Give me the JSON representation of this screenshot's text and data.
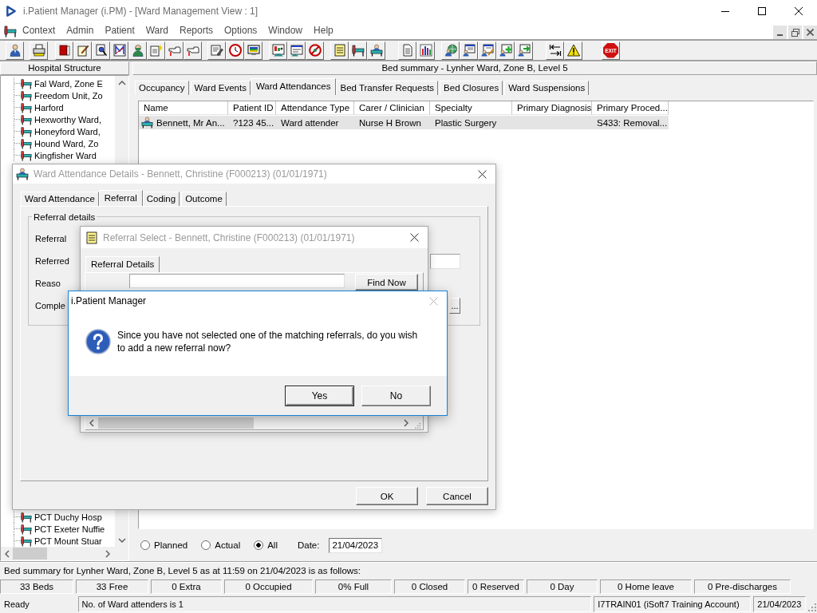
{
  "window": {
    "title": "i.Patient Manager (i.PM) - [Ward Management View : 1]",
    "active": false
  },
  "menu": [
    "Context",
    "Admin",
    "Patient",
    "Ward",
    "Reports",
    "Options",
    "Window",
    "Help"
  ],
  "toolbar": {
    "exit_label": "EXIT"
  },
  "hospital_structure": {
    "title": "Hospital Structure",
    "items_top": [
      "Fal Ward, Zone E",
      "Freedom Unit, Zo",
      "Harford",
      "Hexworthy Ward,",
      "Honeyford Ward,",
      "Hound Ward, Zo",
      "Kingfisher Ward"
    ],
    "items_bottom": [
      "PCT Duchy Hosp",
      "PCT Exeter Nuffie",
      "PCT Mount Stuar"
    ]
  },
  "ward_view": {
    "title": "Bed summary - Lynher Ward, Zone B, Level 5",
    "tabs": [
      {
        "label": "Occupancy",
        "selected": false
      },
      {
        "label": "Ward Events",
        "selected": false
      },
      {
        "label": "Ward Attendances",
        "selected": true
      },
      {
        "label": "Bed Transfer Requests",
        "selected": false
      },
      {
        "label": "Bed Closures",
        "selected": false
      },
      {
        "label": "Ward Suspensions",
        "selected": false
      }
    ],
    "table": {
      "columns": [
        "Name",
        "Patient ID",
        "Attendance Type",
        "Carer / Clinician",
        "Specialty",
        "Primary Diagnosis",
        "Primary Proced..."
      ],
      "rows": [
        {
          "selected": true,
          "name": "Bennett, Mr An...",
          "patient_id": "?123 45...",
          "attendance_type": "Ward attender",
          "carer_clinician": "Nurse H Brown",
          "specialty": "Plastic Surgery",
          "primary_procedure": "S433: Removal..."
        }
      ]
    },
    "filter": {
      "options": [
        {
          "label": "Planned",
          "selected": false
        },
        {
          "label": "Actual",
          "selected": false
        },
        {
          "label": "All",
          "selected": true
        }
      ],
      "date_label": "Date:",
      "date": "21/04/2023"
    }
  },
  "bed_summary": {
    "text": "Bed summary for Lynher Ward, Zone B, Level 5 as at 11:59 on 21/04/2023 is as follows:",
    "counts": [
      "33 Beds",
      "33 Free",
      "0 Extra",
      "0 Occupied",
      "0% Full",
      "0 Closed",
      "0 Reserved",
      "0 Day",
      "0 Home leave",
      "0 Pre-discharges"
    ]
  },
  "status_bar": [
    "Ready",
    "No. of Ward attenders is 1",
    "I7TRAIN01 (iSoft7 Training Account)",
    "21/04/2023"
  ],
  "ward_attendance_dialog": {
    "title": "Ward Attendance Details - Bennett, Christine (F000213) (01/01/1971)",
    "active": false,
    "tabs": [
      {
        "label": "Ward Attendance",
        "selected": false
      },
      {
        "label": "Referral",
        "selected": true
      },
      {
        "label": "Coding",
        "selected": false
      },
      {
        "label": "Outcome",
        "selected": false
      }
    ],
    "group_title": "Referral details",
    "field_labels": [
      "Referral",
      "Referred",
      "Reaso",
      "Comple"
    ],
    "browse_button": "...",
    "buttons": [
      "OK",
      "Cancel"
    ]
  },
  "referral_select_dialog": {
    "title": "Referral Select - Bennett, Christine (F000213) (01/01/1971)",
    "active": false,
    "tabs": [
      {
        "label": "Referral Details",
        "selected": true
      }
    ],
    "find_button": "Find Now"
  },
  "message_box": {
    "title": "i.Patient Manager",
    "active": true,
    "close_disabled": true,
    "message": "Since you have not selected one of the matching referrals, do you wish to add a new referral now?",
    "buttons": [
      {
        "label": "Yes",
        "default": true
      },
      {
        "label": "No",
        "default": false
      }
    ]
  }
}
